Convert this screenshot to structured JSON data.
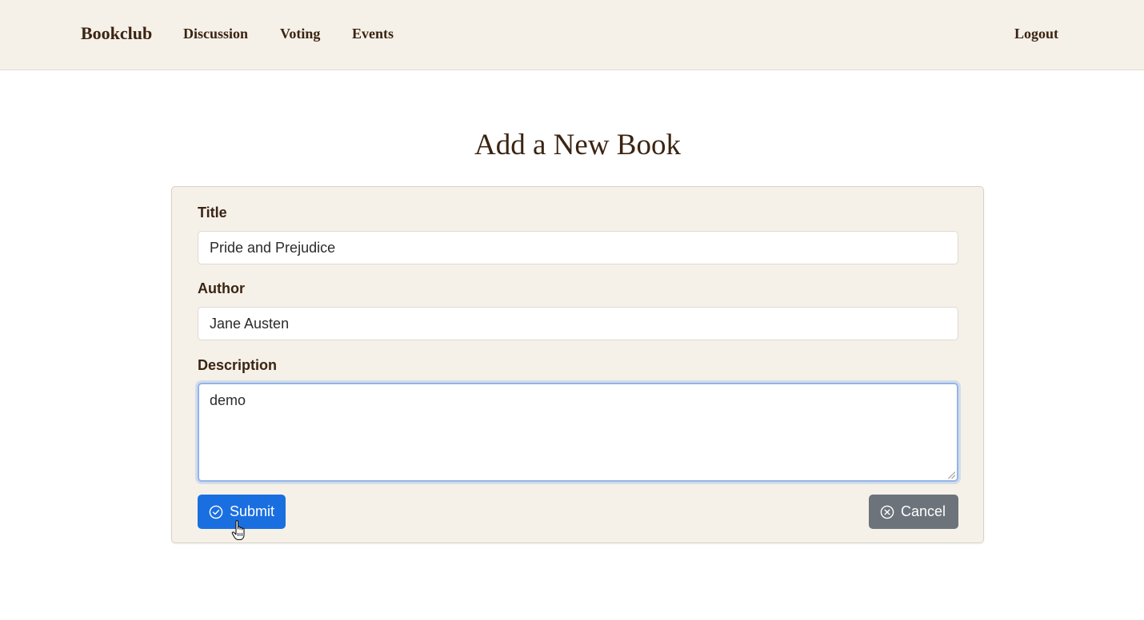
{
  "navbar": {
    "brand": "Bookclub",
    "links": [
      "Discussion",
      "Voting",
      "Events"
    ],
    "logout": "Logout"
  },
  "page": {
    "title": "Add a New Book"
  },
  "form": {
    "title_label": "Title",
    "title_value": "Pride and Prejudice",
    "author_label": "Author",
    "author_value": "Jane Austen",
    "description_label": "Description",
    "description_value": "demo",
    "submit_label": "Submit",
    "cancel_label": "Cancel"
  },
  "icons": {
    "submit": "check-circle-icon",
    "cancel": "x-circle-icon",
    "cursor": "hand-pointer-cursor"
  },
  "colors": {
    "navbar_bg": "#f5f1e9",
    "text_brown": "#3b2412",
    "submit_blue": "#1a6fe0",
    "cancel_gray": "#6c737b",
    "focus_ring": "#93b4ea"
  }
}
